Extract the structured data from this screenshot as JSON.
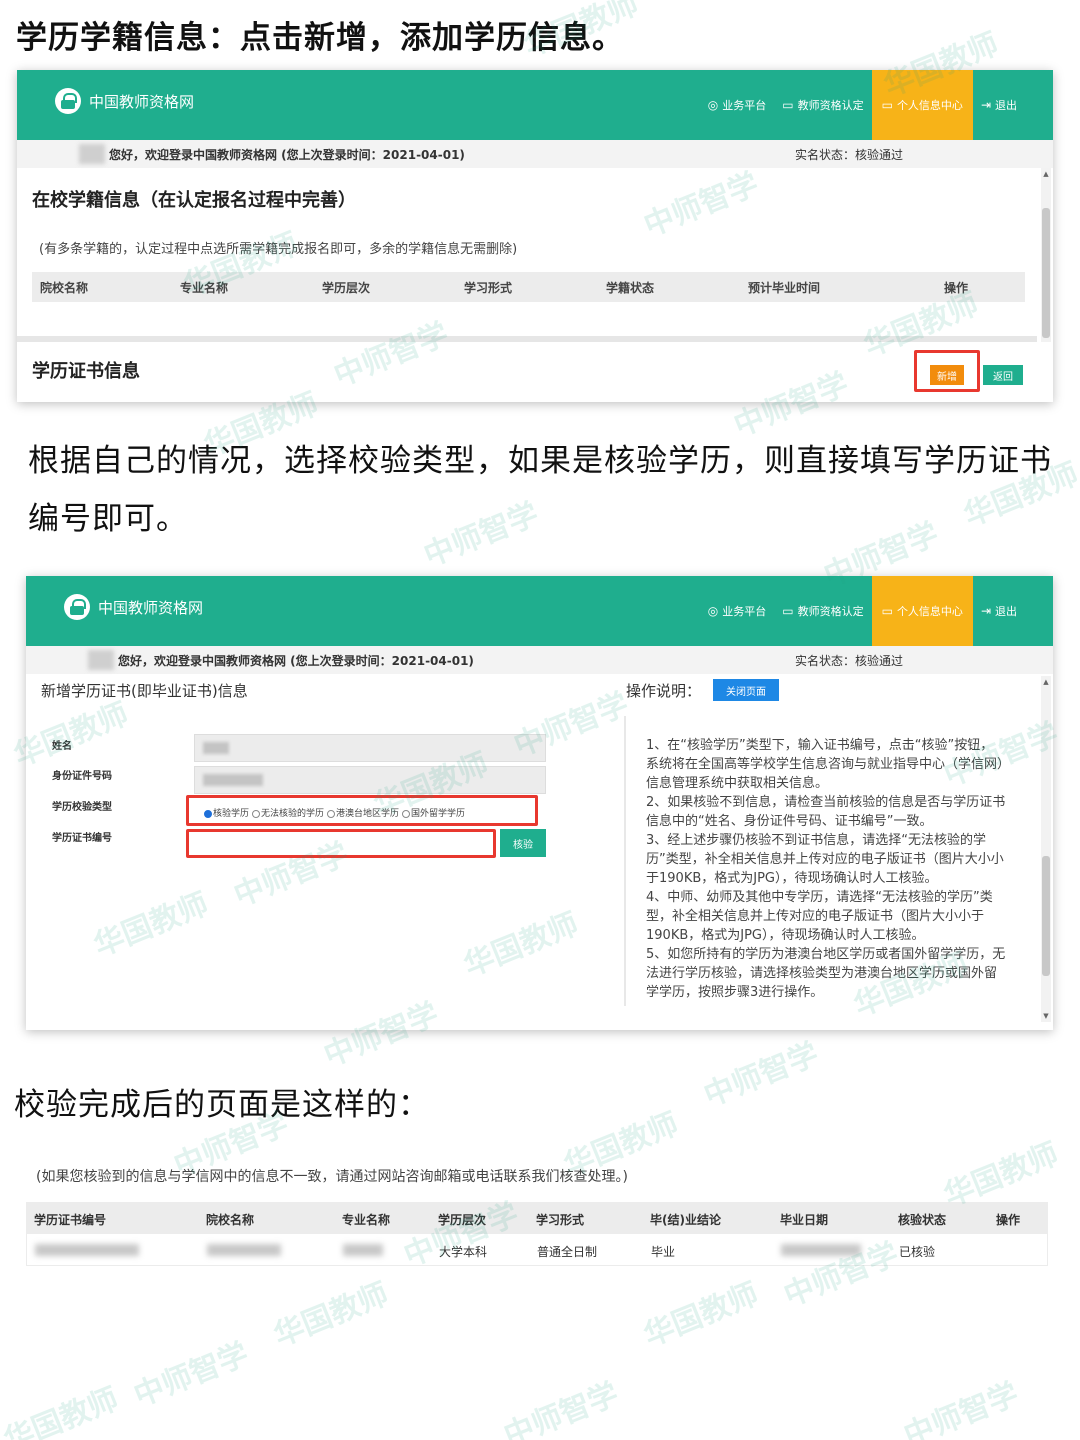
{
  "heading1": "学历学籍信息：点击新增，添加学历信息。",
  "para2": "根据自己的情况，选择校验类型，如果是核验学历，则直接填写学历证书编号即可。",
  "heading3": "校验完成后的页面是这样的：",
  "site": {
    "name": "中国教师资格网",
    "nav": [
      "业务平台",
      "教师资格认定",
      "个人信息中心",
      "退出"
    ],
    "welcome": "您好，欢迎登录中国教师资格网 (您上次登录时间：2021-04-01)",
    "realname_status": "实名状态：核验通过"
  },
  "screen1": {
    "school_title": "在校学籍信息（在认定报名过程中完善）",
    "school_note": "(有多条学籍的，认定过程中点选所需学籍完成报名即可，多余的学籍信息无需删除)",
    "columns": [
      "院校名称",
      "专业名称",
      "学历层次",
      "学习形式",
      "学籍状态",
      "预计毕业时间",
      "操作"
    ],
    "cert_title": "学历证书信息",
    "add_button": "新增",
    "back_button": "返回"
  },
  "screen2": {
    "form_title": "新增学历证书(即毕业证书)信息",
    "ops_label": "操作说明：",
    "close_button": "关闭页面",
    "fields": [
      "姓名",
      "身份证件号码",
      "学历校验类型",
      "学历证书编号"
    ],
    "radio_options": [
      "核验学历",
      "无法核验的学历",
      "港澳台地区学历",
      "国外留学学历"
    ],
    "verify_button": "核验",
    "instructions": [
      "1、在“核验学历”类型下，输入证书编号，点击“核验”按钮，系统将在全国高等学校学生信息咨询与就业指导中心（学信网）信息管理系统中获取相关信息。",
      "2、如果核验不到信息，请检查当前核验的信息是否与学历证书信息中的“姓名、身份证件号码、证书编号”一致。",
      "3、经上述步骤仍核验不到证书信息，请选择“无法核验的学历”类型，补全相关信息并上传对应的电子版证书（图片大小小于190KB，格式为JPG），待现场确认时人工核验。",
      "4、中师、幼师及其他中专学历，请选择“无法核验的学历”类型，补全相关信息并上传对应的电子版证书（图片大小小于190KB，格式为JPG），待现场确认时人工核验。",
      "5、如您所持有的学历为港澳台地区学历或者国外留学学历，无法进行学历核验，请选择核验类型为港澳台地区学历或国外留学学历，按照步骤3进行操作。"
    ]
  },
  "screen3": {
    "note": "(如果您核验到的信息与学信网中的信息不一致，请通过网站咨询邮箱或电话联系我们核查处理。)",
    "columns": [
      "学历证书编号",
      "院校名称",
      "专业名称",
      "学历层次",
      "学习形式",
      "毕(结)业结论",
      "毕业日期",
      "核验状态",
      "操作"
    ],
    "row": {
      "level": "大学本科",
      "form": "普通全日制",
      "conclusion": "毕业",
      "status": "已核验"
    }
  },
  "watermark": [
    "华国教师",
    "中师智学"
  ]
}
